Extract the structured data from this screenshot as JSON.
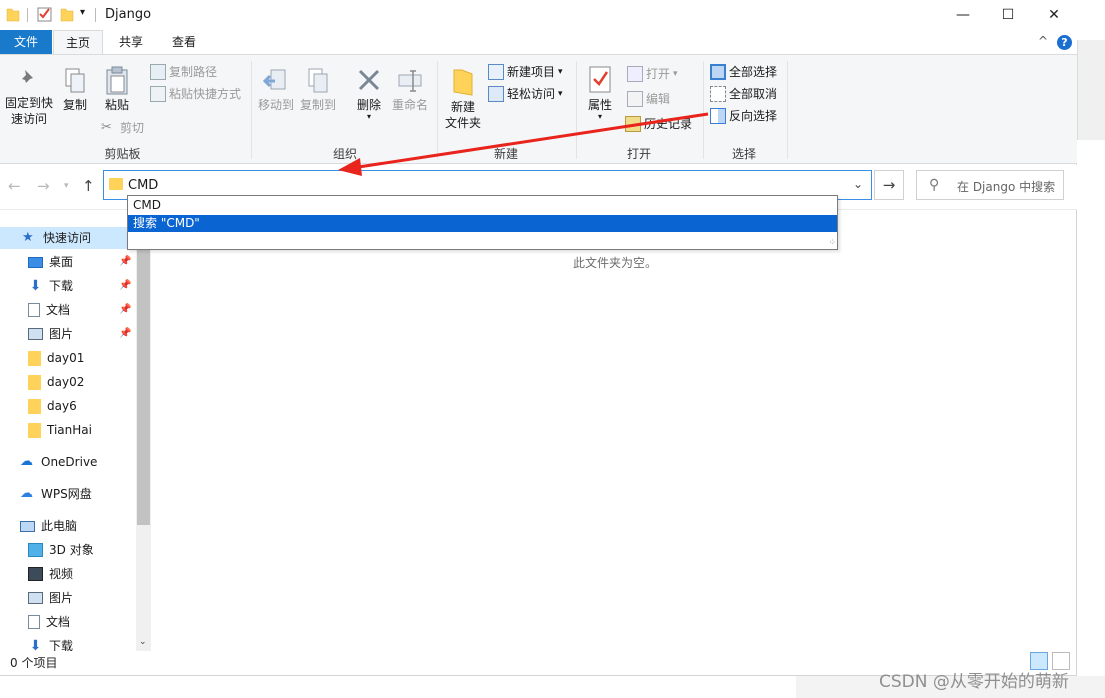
{
  "window": {
    "title": "Django",
    "controls": {
      "minimize": "—",
      "maximize": "☐",
      "close": "✕"
    }
  },
  "ribbon_tabs": [
    "文件",
    "主页",
    "共享",
    "查看"
  ],
  "ribbon": {
    "clipboard": {
      "group_label": "剪贴板",
      "pin_label_1": "固定到快",
      "pin_label_2": "速访问",
      "copy": "复制",
      "paste": "粘贴",
      "copy_path": "复制路径",
      "paste_shortcut": "粘贴快捷方式",
      "cut": "剪切"
    },
    "organize": {
      "group_label": "组织",
      "move_to": "移动到",
      "copy_to": "复制到",
      "delete": "删除",
      "rename": "重命名"
    },
    "new": {
      "group_label": "新建",
      "new_folder_1": "新建",
      "new_folder_2": "文件夹",
      "new_item": "新建项目",
      "easy_access": "轻松访问"
    },
    "open": {
      "group_label": "打开",
      "properties": "属性",
      "open": "打开",
      "edit": "编辑",
      "history": "历史记录"
    },
    "select": {
      "group_label": "选择",
      "select_all": "全部选择",
      "select_none": "全部取消",
      "invert": "反向选择"
    }
  },
  "address": {
    "value": "CMD",
    "search_placeholder": "在 Django 中搜索"
  },
  "dropdown": {
    "items": [
      "CMD",
      "搜索 \"CMD\""
    ]
  },
  "nav": {
    "quick_access": "快速访问",
    "items": [
      "桌面",
      "下载",
      "文档",
      "图片",
      "day01",
      "day02",
      "day6",
      "TianHai"
    ],
    "onedrive": "OneDrive",
    "wps": "WPS网盘",
    "this_pc": "此电脑",
    "pc_items": [
      "3D 对象",
      "视频",
      "图片",
      "文档",
      "下载"
    ]
  },
  "content": {
    "empty_message": "此文件夹为空。"
  },
  "status": {
    "item_count": "0 个项目"
  },
  "watermark": "CSDN @从零开始的萌新",
  "colors": {
    "accent": "#1979ca",
    "selection": "#0a64d2",
    "annotation_arrow": "#e8241c",
    "folder": "#ffd35a"
  }
}
